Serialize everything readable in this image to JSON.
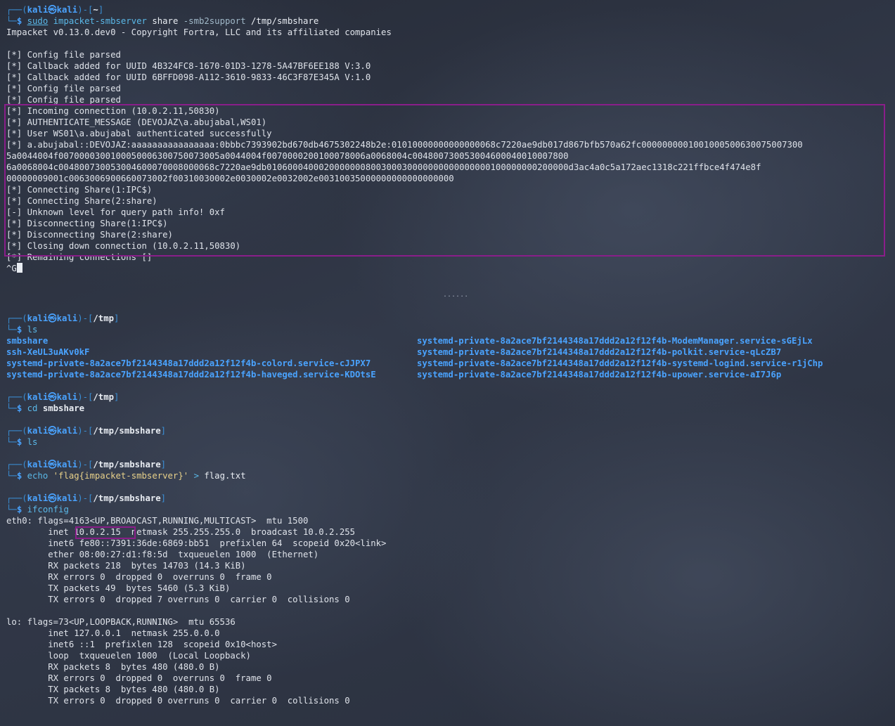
{
  "prompt": {
    "user": "kali",
    "at": "㉿",
    "host": "kali",
    "dollar": "$"
  },
  "block1": {
    "path": "~",
    "cmd_sudo": "sudo",
    "cmd_name": "impacket-smbserver",
    "arg1": "share",
    "flag1": "-smb2support",
    "arg2": "/tmp/smbshare",
    "output": [
      "Impacket v0.13.0.dev0 - Copyright Fortra, LLC and its affiliated companies",
      "",
      "[*] Config file parsed",
      "[*] Callback added for UUID 4B324FC8-1670-01D3-1278-5A47BF6EE188 V:3.0",
      "[*] Callback added for UUID 6BFFD098-A112-3610-9833-46C3F87E345A V:1.0",
      "[*] Config file parsed",
      "[*] Config file parsed",
      "[*] Incoming connection (10.0.2.11,50830)",
      "[*] AUTHENTICATE_MESSAGE (DEVOJAZ\\a.abujabal,WS01)",
      "[*] User WS01\\a.abujabal authenticated successfully",
      "[*] a.abujabal::DEVOJAZ:aaaaaaaaaaaaaaaa:0bbbc7393902bd670db4675302248b2e:01010000000000000068c7220ae9db017d867bfb570a62fc0000000001001000500630075007300",
      "5a0044004f0070000300100050006300750073005a0044004f0070000200100078006a0068004c004800730053004600040010007800",
      "6a0068004c004800730053004600070008000068c7220ae9db0106000400020000000800300030000000000000000100000000200000d3ac4a0c5a172aec1318c221ffbce4f474e8f",
      "00000009001c0063006900660073002f00310030002e0030002e0032002e00310035000000000000000000",
      "[*] Connecting Share(1:IPC$)",
      "[*] Connecting Share(2:share)",
      "[-] Unknown level for query path info! 0xf",
      "[*] Disconnecting Share(1:IPC$)",
      "[*] Disconnecting Share(2:share)",
      "[*] Closing down connection (10.0.2.11,50830)",
      "[*] Remaining connections []"
    ],
    "interrupt": "^G"
  },
  "separator": "......",
  "block2": {
    "path": "/tmp",
    "cmd": "ls",
    "col1": [
      "smbshare",
      "ssh-XeUL3uAKv0kF",
      "systemd-private-8a2ace7bf2144348a17ddd2a12f12f4b-colord.service-cJJPX7",
      "systemd-private-8a2ace7bf2144348a17ddd2a12f12f4b-haveged.service-KDOtsE"
    ],
    "col2": [
      "systemd-private-8a2ace7bf2144348a17ddd2a12f12f4b-ModemManager.service-sGEjLx",
      "systemd-private-8a2ace7bf2144348a17ddd2a12f12f4b-polkit.service-qLcZB7",
      "systemd-private-8a2ace7bf2144348a17ddd2a12f12f4b-systemd-logind.service-r1jChp",
      "systemd-private-8a2ace7bf2144348a17ddd2a12f12f4b-upower.service-aI7J6p"
    ]
  },
  "block3": {
    "path": "/tmp",
    "cmd": "cd",
    "arg": "smbshare"
  },
  "block4": {
    "path": "/tmp/smbshare",
    "cmd": "ls"
  },
  "block5": {
    "path": "/tmp/smbshare",
    "cmd": "echo",
    "str": "'flag{impacket-smbserver}'",
    "redir": ">",
    "file": "flag.txt"
  },
  "block6": {
    "path": "/tmp/smbshare",
    "cmd": "ifconfig",
    "eth0_header": "eth0: flags=4163<UP,BROADCAST,RUNNING,MULTICAST>  mtu 1500",
    "eth0_inet_prefix": "        inet ",
    "eth0_inet_ip": "10.0.2.15",
    "eth0_inet_suffix": "  netmask 255.255.255.0  broadcast 10.0.2.255",
    "eth0_rest": [
      "        inet6 fe80::7391:36de:6869:bb51  prefixlen 64  scopeid 0x20<link>",
      "        ether 08:00:27:d1:f8:5d  txqueuelen 1000  (Ethernet)",
      "        RX packets 218  bytes 14703 (14.3 KiB)",
      "        RX errors 0  dropped 0  overruns 0  frame 0",
      "        TX packets 49  bytes 5460 (5.3 KiB)",
      "        TX errors 0  dropped 7 overruns 0  carrier 0  collisions 0",
      "",
      "lo: flags=73<UP,LOOPBACK,RUNNING>  mtu 65536",
      "        inet 127.0.0.1  netmask 255.0.0.0",
      "        inet6 ::1  prefixlen 128  scopeid 0x10<host>",
      "        loop  txqueuelen 1000  (Local Loopback)",
      "        RX packets 8  bytes 480 (480.0 B)",
      "        RX errors 0  dropped 0  overruns 0  frame 0",
      "        TX packets 8  bytes 480 (480.0 B)",
      "        TX errors 0  dropped 0 overruns 0  carrier 0  collisions 0"
    ]
  }
}
